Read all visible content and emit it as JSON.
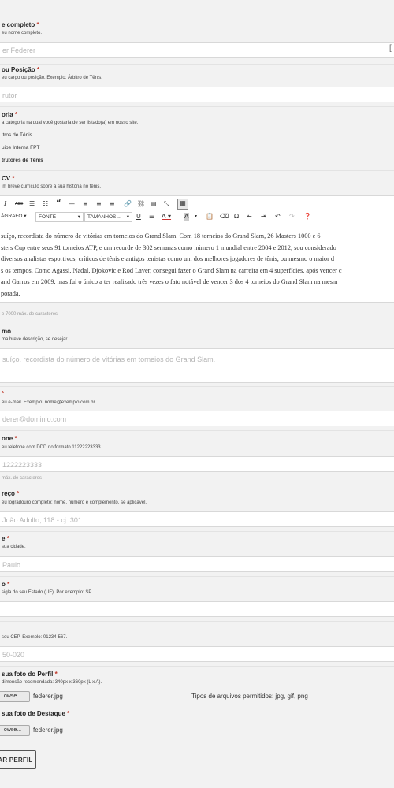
{
  "name_field": {
    "label": "e completo",
    "desc": "eu nome completo.",
    "value": "er Federer"
  },
  "position_field": {
    "label": " ou Posição",
    "desc": "eu cargo ou posição. Exemplo: Árbitro de Tênis.",
    "value": "rutor"
  },
  "category_field": {
    "label": "oria",
    "desc": "a categoria na qual você gostaria de ser listado(a) em nosso site.",
    "options": [
      "itros de Tênis",
      "uipe Interna FPT",
      "trutores de Tênis"
    ]
  },
  "cv_field": {
    "label": "CV",
    "desc": "im breve currículo sobre a sua história no tênis.",
    "toolbar": {
      "select_paragraph": "ÁGRAFO",
      "select_font": "FONTE",
      "select_size": "TAMANHOS ...",
      "icons": [
        "italic-icon",
        "strikethrough-icon",
        "ordered-list-icon",
        "unordered-list-icon",
        "blockquote-icon",
        "horizontal-rule-icon",
        "align-left-icon",
        "align-center-icon",
        "align-right-icon",
        "link-icon",
        "unlink-icon",
        "insert-more-icon",
        "fullscreen-icon",
        "toolbar-toggle-icon",
        "underline-icon",
        "justify-icon",
        "text-color-icon",
        "background-color-icon",
        "paste-text-icon",
        "clear-format-icon",
        "special-char-icon",
        "outdent-icon",
        "indent-icon",
        "undo-icon",
        "redo-icon",
        "help-icon"
      ]
    },
    "lines": [
      "suíço, recordista do número de vitórias em torneios do Grand Slam. Com 18 torneios do Grand Slam, 26 Masters 1000 e 6",
      "sters Cup entre seus 91 torneios ATP, e um recorde de 302 semanas como número 1 mundial entre 2004 e 2012, sou considerado",
      "diversos analistas esportivos, críticos de tênis e antigos tenistas como um dos melhores jogadores de tênis, ou mesmo o maior d",
      "s os tempos. Como Agassi, Nadal, Djokovic e Rod Laver, consegui fazer o Grand Slam na carreira em 4 superfícies, após vencer c",
      "and Garros em 2009, mas fui o único a ter realizado três vezes o fato notável de vencer 3 dos 4 torneios do Grand Slam na mesm",
      "porada."
    ],
    "counter": "e 7000 máx. de caracteres"
  },
  "summary_field": {
    "label": "mo",
    "desc": "ma breve descrição, se desejar.",
    "value": "suíço, recordista do número de vitórias em torneios do Grand Slam."
  },
  "email_field": {
    "label": "",
    "desc": "eu e-mail. Exemplo: nome@exemplo.com.br",
    "value": "derer@dominio.com"
  },
  "phone_field": {
    "label": "one",
    "desc": "eu telefone com DDD no formato 11222223333.",
    "value": "1222223333",
    "counter": "máx. de caracteres"
  },
  "address_field": {
    "label": "reço",
    "desc": "eu logradouro completo: nome, número e complemento, se aplicável.",
    "value": "João Adolfo, 118 - cj. 301"
  },
  "city_field": {
    "label": "e",
    "desc": "sua cidade.",
    "value": "Paulo"
  },
  "state_field": {
    "label": "o",
    "desc": "sigla do seu Estado (UF). Por exemplo: SP",
    "value": ""
  },
  "cep_field": {
    "desc": "seu CEP. Exemplo: 01234-567.",
    "value": "50-020"
  },
  "profile_photo": {
    "label": "sua foto do Perfil",
    "desc": "dimensão recomendada: 340px x 360px (L x A).",
    "browse": "owse...",
    "file": "federer.jpg",
    "allowed": "Tipos de arquivos permitidos: jpg, gif, png"
  },
  "featured_photo": {
    "label": "sua foto de Destaque",
    "browse": "owse...",
    "file": "federer.jpg"
  },
  "submit": {
    "label": "IAR PERFIL"
  },
  "colors": {
    "required": "#c0392b",
    "background": "#f2f2f2"
  }
}
